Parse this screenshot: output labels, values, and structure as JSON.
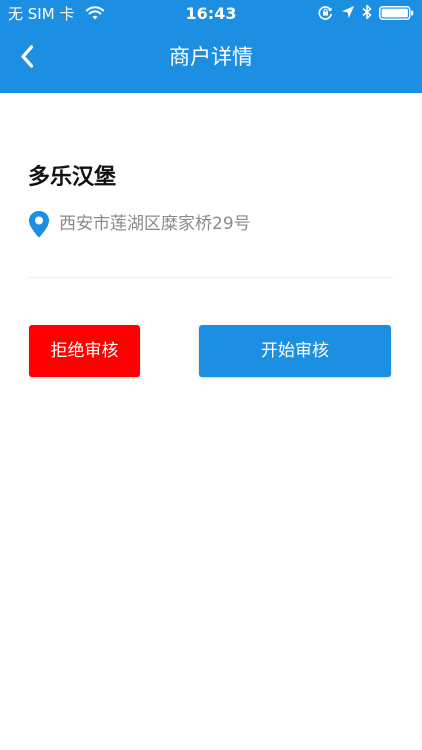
{
  "status_bar": {
    "carrier": "无 SIM 卡",
    "time": "16:43",
    "icons": [
      "wifi-icon",
      "lock-rotation-icon",
      "location-arrow-icon",
      "bluetooth-icon",
      "battery-icon"
    ]
  },
  "nav": {
    "title": "商户详情",
    "back_icon": "chevron-left-icon"
  },
  "merchant": {
    "name": "多乐汉堡",
    "address": "西安市莲湖区糜家桥29号",
    "address_icon": "location-pin-icon"
  },
  "actions": {
    "reject_label": "拒绝审核",
    "start_label": "开始审核"
  },
  "colors": {
    "primary": "#1C8FE3",
    "reject": "#FF0000",
    "address_text": "#8A8A8A"
  }
}
